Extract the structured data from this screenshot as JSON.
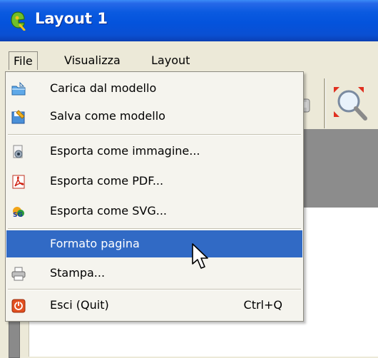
{
  "window": {
    "title": "Layout 1",
    "icon": "qgis-logo-icon"
  },
  "menubar": {
    "items": [
      "File",
      "Visualizza",
      "Layout"
    ],
    "open_menu": "File"
  },
  "file_menu": {
    "items": [
      {
        "label": "Carica dal modello",
        "icon": "open-template-icon",
        "shortcut": ""
      },
      {
        "label": "Salva come modello",
        "icon": "save-template-icon",
        "shortcut": ""
      },
      {
        "label": "Esporta come immagine...",
        "icon": "export-image-icon",
        "shortcut": ""
      },
      {
        "label": "Esporta come PDF...",
        "icon": "pdf-icon",
        "shortcut": ""
      },
      {
        "label": "Esporta come SVG...",
        "icon": "svg-icon",
        "shortcut": ""
      },
      {
        "label": "Formato pagina",
        "icon": "",
        "shortcut": "",
        "selected": true
      },
      {
        "label": "Stampa...",
        "icon": "printer-icon",
        "shortcut": ""
      },
      {
        "label": "Esci (Quit)",
        "icon": "quit-icon",
        "shortcut": "Ctrl+Q"
      }
    ]
  },
  "colors": {
    "titlebar": "#0a5ae0",
    "menu_background": "#f5f4ee",
    "selection": "#316ac5",
    "canvas": "#8c8c8c"
  }
}
